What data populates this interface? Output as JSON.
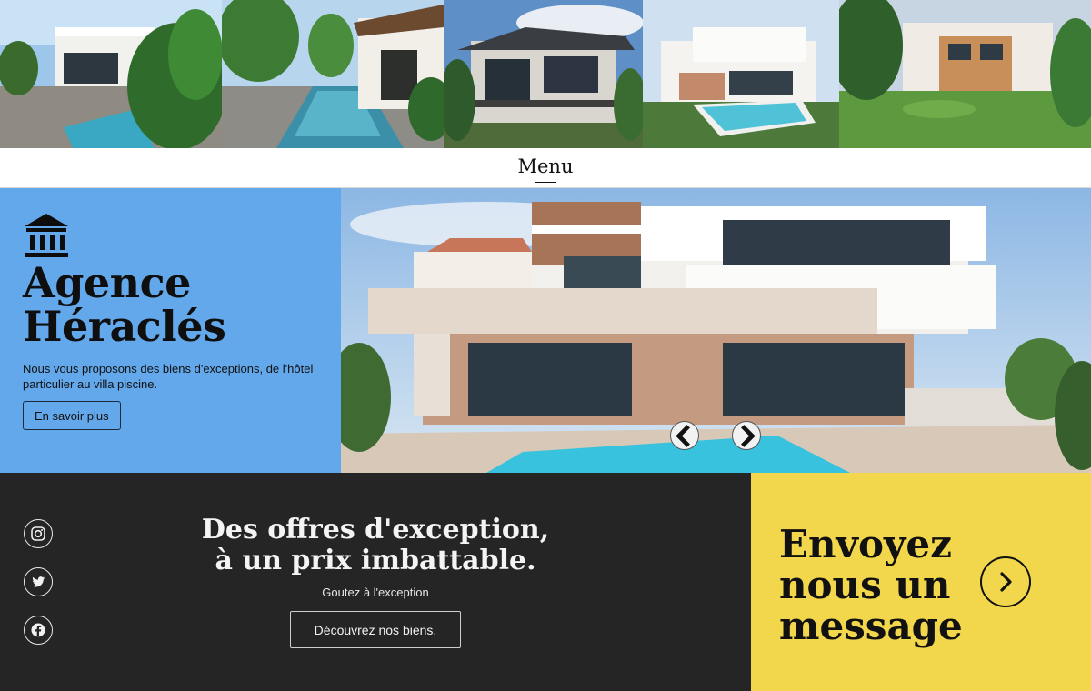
{
  "gallery": {
    "photos": [
      "villa-photo-1",
      "villa-photo-2",
      "villa-photo-3",
      "villa-photo-4",
      "villa-photo-5"
    ]
  },
  "nav": {
    "menu_label": "Menu"
  },
  "hero": {
    "logo_icon": "bank-building-icon",
    "title_line1": "Agence",
    "title_line2": "Héraclés",
    "description": "Nous vous proposons des biens d'exceptions, de l'hôtel particulier au villa piscine.",
    "cta_label": "En savoir plus",
    "prev_icon": "chevron-left-icon",
    "next_icon": "chevron-right-icon",
    "bg_color": "#63a8eb"
  },
  "offers": {
    "title_line1": "Des offres d'exception,",
    "title_line2": "à un prix imbattable.",
    "subtitle": "Goutez à l'exception",
    "cta_label": "Découvrez nos biens.",
    "social": [
      "instagram-icon",
      "twitter-icon",
      "facebook-icon"
    ],
    "bg_color": "#252525"
  },
  "contact": {
    "line1": "Envoyez",
    "line2": "nous un",
    "line3": "message",
    "arrow_icon": "chevron-right-icon",
    "bg_color": "#f2d64b"
  }
}
